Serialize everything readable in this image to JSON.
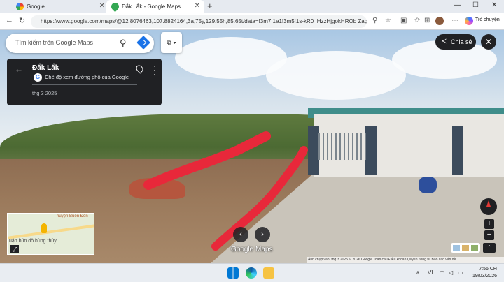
{
  "browser": {
    "tabs": [
      {
        "label": "Google",
        "active": false
      },
      {
        "label": "Đắk Lắk - Google Maps",
        "active": true
      }
    ],
    "url": "https://www.google.com/maps/@12.8076463,107.8824164,3a,75y,129.55h,85.65t/data=!3m7!1e1!3m5!1s-kR0_HzzHjgokHROb Zag2...",
    "copilot_label": "Trò chuyện"
  },
  "maps": {
    "search_placeholder": "Tìm kiếm trên Google Maps",
    "place_title": "Đắk Lắk",
    "streetview_label": "Chế độ xem đường phố của Google",
    "capture_date": "thg 3 2025",
    "share_label": "Chia sẻ",
    "minimap_label_top": "huyện Buôn Đôn",
    "minimap_label_bottom": "uận bún đỏ hùng thủy",
    "logo": "Google Maps",
    "footer": "Ảnh chụp vào: thg 3 2025   © 2026 Google   Toàn cầu   Điều khoản   Quyền riêng tư   Báo cáo vấn đề",
    "accent_color": "#1a73e8"
  },
  "taskbar": {
    "time": "7:56 CH",
    "date": "19/03/2026"
  }
}
